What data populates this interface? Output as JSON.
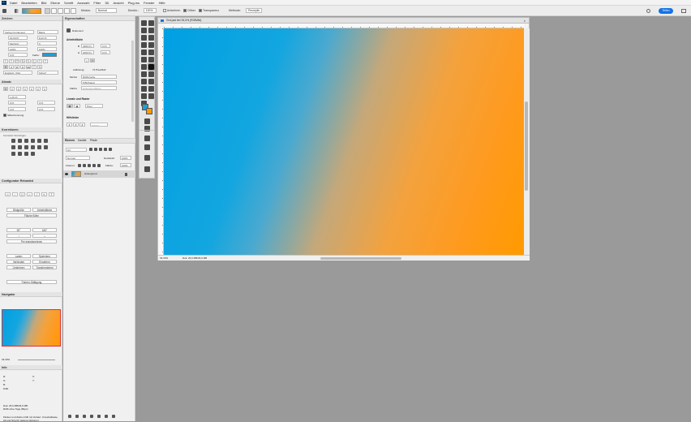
{
  "menu": {
    "logo": "Ps",
    "items": [
      "Datei",
      "Bearbeiten",
      "Bild",
      "Ebene",
      "Schrift",
      "Auswahl",
      "Filter",
      "3D",
      "Ansicht",
      "Plug-ins",
      "Fenster",
      "Hilfe"
    ]
  },
  "options": {
    "modus_label": "Modus:",
    "modus_value": "Normal",
    "deckkr_label": "Deckkr.:",
    "deckkr_value": "100%",
    "umkehren": "Umkehren",
    "dither": "Dither",
    "transparenz": "Transparenz",
    "methode_label": "Methode:",
    "methode_value": "Perzeptiv",
    "share_button": "Teilen",
    "gradient_colors": [
      "#1ea5df",
      "#f6a23a",
      "#ff9900"
    ]
  },
  "zeichen": {
    "title": "Zeichen",
    "font": "Verlag Condensed",
    "style": "Black",
    "size": "20,09 Pt",
    "leading": "8,22 Pt",
    "kerning": "Metrisch",
    "tracking": "0",
    "vscale": "100%",
    "hscale": "100%",
    "baseline": "0 Pt",
    "color_label": "Farbe:",
    "language": "Englisch: USA",
    "aa": "Scharf",
    "swatch": "#1a9fe0"
  },
  "absatz": {
    "title": "Absatz",
    "indent_left": "1,05 Pt",
    "indent_right": "0 Pt",
    "indent_first": "0 Pt",
    "space_before": "0 Pt",
    "space_after": "0 Pt",
    "hyphenation": "Silbentrennung"
  },
  "korrekturen": {
    "title": "Korrekturen",
    "subtitle": "Korrektur hinzufügen"
  },
  "konfigurator": {
    "title": "Configurator Reloaded",
    "b1": "Bildgröße",
    "b2": "Arbeitsfläche",
    "b3": "Fläche füllen",
    "angle1": "90°",
    "angle2": "180°",
    "b4": "Per transformieren",
    "b5": "Laden",
    "b6": "Speichern",
    "b7": "Verbinden",
    "b8": "Erweitern",
    "b9": "Umkehren",
    "b10": "Transformieren",
    "b11": "Farben-Sättigung"
  },
  "navigator": {
    "title": "Navigator",
    "zoom": "33,33%"
  },
  "info": {
    "title": "Info",
    "r_label": "R:",
    "g_label": "G:",
    "b_label": "B:",
    "depth": "8-Bit",
    "x_label": "X:",
    "y_label": "Y:",
    "doc": "Dok: 26,6 MB/26,6 MB",
    "doc2": "RGB ohne Tags (8bpc)",
    "hint": "Klicken und Ziehen füllt mit Verlauf. Umschalttaste, Alt und Strg für weitere Optionen."
  },
  "eigenschaften": {
    "title": "Eigenschaften",
    "doc_label": "Dokument",
    "arbeitsflaeche": "Arbeitsfläche",
    "w_label": "B",
    "w_value": "4000 Px",
    "h_label": "H",
    "h_value": "2000 Px",
    "x_value": "0 Px",
    "y_value": "0 Px",
    "res_label": "Auflösung:",
    "res_value": "72 Pixel/Zoll",
    "mode_label": "Modus",
    "mode_value": "RGB-Farbe",
    "depth_value": "8 Bit/Kanal",
    "fill_label": "Fläche",
    "fill_value": "Hintergrundfarbe",
    "lineale": "Lineale und Raster",
    "unit": "Pixel",
    "hilfslinien": "Hilfslinien"
  },
  "ebenen": {
    "tabs": [
      "Ebenen",
      "Kanäle",
      "Pfade"
    ],
    "search": "Art",
    "blend": "Normal",
    "opacity_label": "Deckkraft:",
    "opacity": "100%",
    "lock_label": "Fixieren:",
    "fill_label": "Fläche:",
    "fill": "100%",
    "layer_name": "Hintergrund"
  },
  "document": {
    "tab": "Grd.psd bei 33,3% (RGB/8#)",
    "zoom": "33,33%",
    "status": "Dok: 26,6 MB/26,6 MB"
  }
}
